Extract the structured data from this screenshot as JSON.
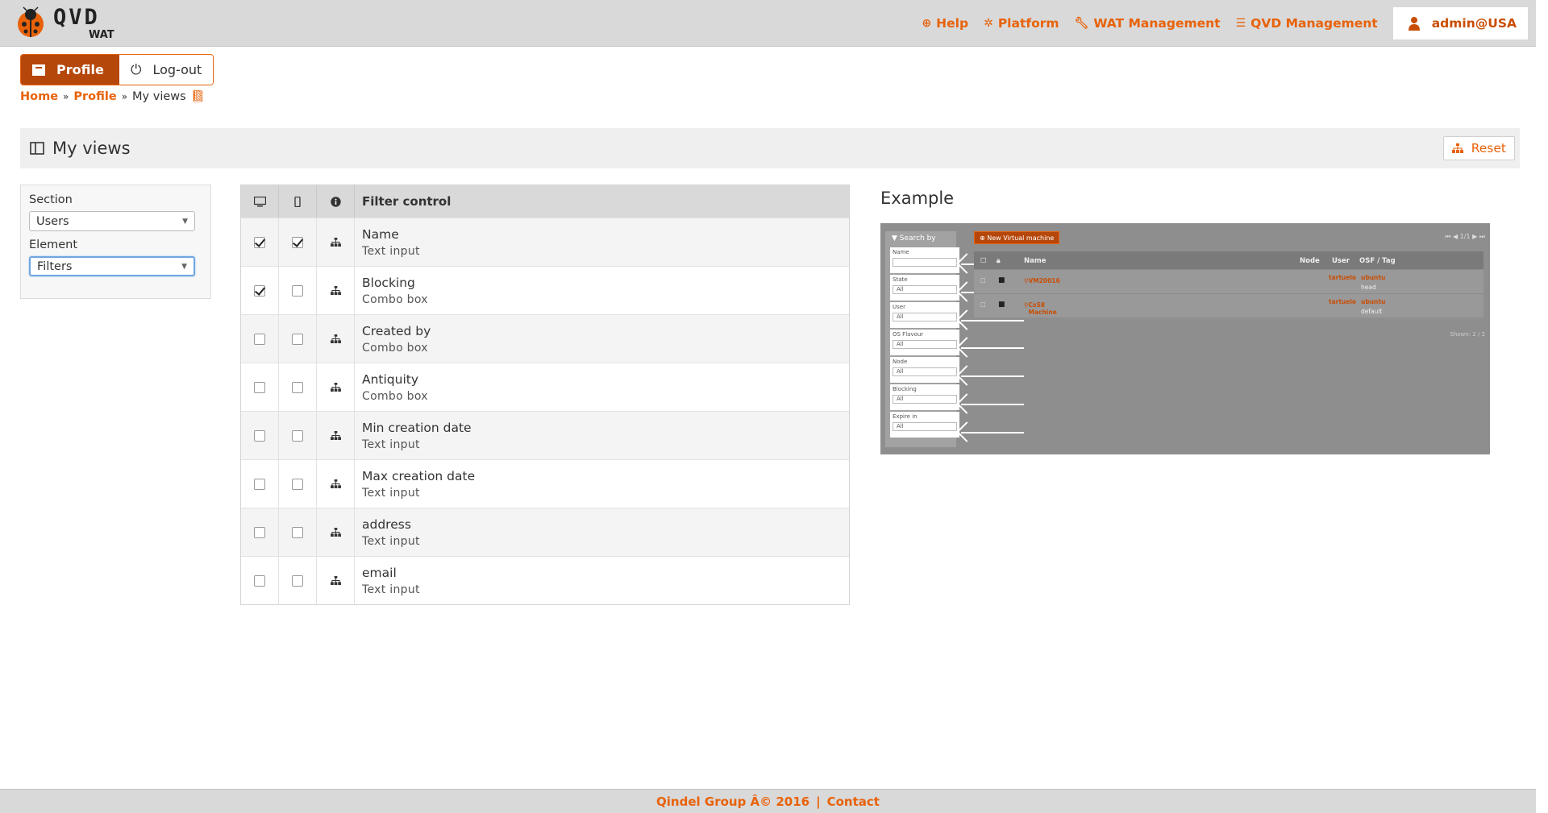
{
  "header": {
    "logo_text": "QVD",
    "logo_sub": "WAT",
    "nav": [
      {
        "label": "Help",
        "icon": "help-icon"
      },
      {
        "label": "Platform",
        "icon": "platform-icon"
      },
      {
        "label": "WAT Management",
        "icon": "wrench-icon"
      },
      {
        "label": "QVD Management",
        "icon": "sliders-icon"
      }
    ],
    "user": "admin@USA"
  },
  "actions": {
    "profile_label": "Profile",
    "logout_label": "Log-out"
  },
  "breadcrumb": {
    "home": "Home",
    "profile": "Profile",
    "current": "My views"
  },
  "titlebar": {
    "title": "My views",
    "reset_label": "Reset"
  },
  "side": {
    "section_label": "Section",
    "section_value": "Users",
    "element_label": "Element",
    "element_value": "Filters"
  },
  "table": {
    "header": "Filter control",
    "rows": [
      {
        "name": "Name",
        "type": "Text input",
        "desktop": true,
        "mobile": true
      },
      {
        "name": "Blocking",
        "type": "Combo box",
        "desktop": true,
        "mobile": false
      },
      {
        "name": "Created by",
        "type": "Combo box",
        "desktop": false,
        "mobile": false
      },
      {
        "name": "Antiquity",
        "type": "Combo box",
        "desktop": false,
        "mobile": false
      },
      {
        "name": "Min creation date",
        "type": "Text input",
        "desktop": false,
        "mobile": false
      },
      {
        "name": "Max creation date",
        "type": "Text input",
        "desktop": false,
        "mobile": false
      },
      {
        "name": "address",
        "type": "Text input",
        "desktop": false,
        "mobile": false
      },
      {
        "name": "email",
        "type": "Text input",
        "desktop": false,
        "mobile": false
      }
    ]
  },
  "example": {
    "title": "Example",
    "search_by": "Search by",
    "new_button": "New Virtual machine",
    "pager": "1/1",
    "fields": [
      {
        "label": "Name",
        "value": ""
      },
      {
        "label": "State",
        "value": "All"
      },
      {
        "label": "User",
        "value": "All"
      },
      {
        "label": "OS Flavour",
        "value": "All"
      },
      {
        "label": "Node",
        "value": "All"
      },
      {
        "label": "Blocking",
        "value": "All"
      },
      {
        "label": "Expire in",
        "value": "All"
      }
    ],
    "columns": [
      "Name",
      "Node",
      "User",
      "OSF / Tag"
    ],
    "rows": [
      {
        "name": "VM20016",
        "user": "tartuelo",
        "osf": "ubuntu",
        "tag": "head"
      },
      {
        "name": "CsS8 Machine",
        "user": "tartuelo",
        "osf": "ubuntu",
        "tag": "default"
      }
    ],
    "shown": "Shown: 2 / 2"
  },
  "footer": {
    "company": "Qindel Group Â© 2016",
    "separator": "|",
    "contact": "Contact"
  },
  "colors": {
    "accent": "#e8620a",
    "accent_dark": "#b6470a",
    "header_bg": "#d9d9d9"
  }
}
